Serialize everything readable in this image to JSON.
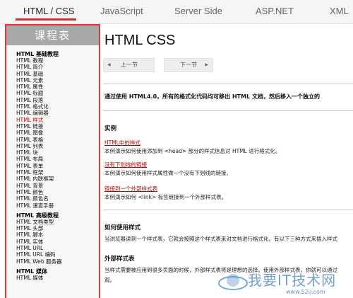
{
  "topnav": {
    "items": [
      "HTML / CSS",
      "JavaScript",
      "Server Side",
      "ASP.NET",
      "XML"
    ],
    "active_index": 0
  },
  "sidebar": {
    "title": "课程表",
    "groups": [
      {
        "title": "HTML 基础教程",
        "links": [
          "HTML 教程",
          "HTML 简介",
          "HTML 基础",
          "HTML 元素",
          "HTML 属性",
          "HTML 标题",
          "HTML 段落",
          "HTML 格式化",
          "HTML 编辑器",
          "HTML 样式",
          "HTML 链接",
          "HTML 图像",
          "HTML 表格",
          "HTML 列表",
          "HTML 块",
          "HTML 布局",
          "HTML 表单",
          "HTML 框架",
          "HTML 内联框架",
          "HTML 背景",
          "HTML 颜色",
          "HTML 颜色名",
          "HTML 速查手册"
        ]
      },
      {
        "title": "HTML 高级教程",
        "links": [
          "HTML 文档类型",
          "HTML 头部",
          "HTML 脚本",
          "HTML 实体",
          "HTML URL",
          "HTML URL 编码",
          "HTML Web 服务器"
        ]
      },
      {
        "title": "HTML 媒体",
        "links": [
          "HTML 媒体"
        ]
      }
    ],
    "current_link": "HTML 样式"
  },
  "main": {
    "title": "HTML CSS",
    "prev_label": "上一节",
    "next_label": "下一节",
    "intro": "通过使用 HTML4.0，所有的格式化代码均可移出 HTML 文档，然后移入一个独立的",
    "examples_title": "实例",
    "examples": [
      {
        "link": "HTML中的样式",
        "desc": "本例演示如何使用添加到 <head> 部分的样式信息对 HTML 进行格式化。"
      },
      {
        "link": "没有下划线的链接",
        "desc": "本例演示如何使用样式属性做一个没有下划线的链接。"
      },
      {
        "link": "链接到一个外部样式表",
        "desc": "本例演示如何 <link> 标签链接到一个外部样式表。"
      }
    ],
    "how_title": "如何使用样式",
    "how_text": "当浏览器读到一个样式表，它就会按照这个样式表来对文档进行格式化。有以下三种方式来插入样式",
    "external_title": "外部样式表",
    "external_text_1": "当样式需要被应用到很多页面的时候，外部样式表将是理想的选择。使用外部样式表，你就可以通过",
    "external_text_2": "观。"
  },
  "watermark": {
    "text": "我要IT技术网",
    "url": "www.52ij.com"
  }
}
